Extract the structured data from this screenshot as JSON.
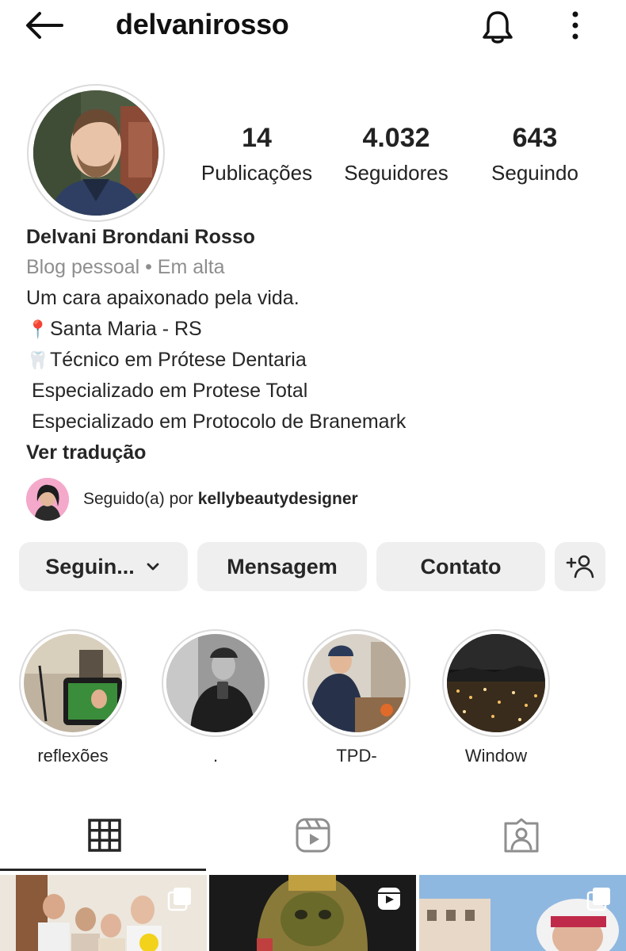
{
  "header": {
    "username": "delvanirosso",
    "back_icon": "arrow-left-icon",
    "notification_icon": "bell-icon",
    "more_icon": "more-vertical-icon"
  },
  "profile": {
    "stats": [
      {
        "value": "14",
        "label": "Publicações"
      },
      {
        "value": "4.032",
        "label": "Seguidores"
      },
      {
        "value": "643",
        "label": "Seguindo"
      }
    ],
    "name": "Delvani Brondani Rosso",
    "category": "Blog pessoal • Em alta",
    "bio_lines": [
      "Um cara apaixonado pela vida.",
      "Santa Maria - RS",
      "Técnico em Prótese Dentaria",
      " Especializado em Protese Total",
      " Especializado em Protocolo de Branemark"
    ],
    "bio_emojis": [
      "📍",
      "🦷"
    ],
    "translate_label": "Ver tradução",
    "followed_by_prefix": "Seguido(a) por ",
    "followed_by_user": "kellybeautydesigner"
  },
  "actions": {
    "following_label": "Seguin...",
    "message_label": "Mensagem",
    "contact_label": "Contato",
    "add_person_icon": "add-person-icon"
  },
  "highlights": [
    {
      "label": "reflexões"
    },
    {
      "label": "."
    },
    {
      "label": "TPD-"
    },
    {
      "label": "Window"
    }
  ],
  "tabs": [
    {
      "icon": "grid-icon",
      "active": true
    },
    {
      "icon": "reels-icon",
      "active": false
    },
    {
      "icon": "tagged-icon",
      "active": false
    }
  ],
  "colors": {
    "button_bg": "#efefef",
    "secondary_text": "#8e8e8e",
    "ring": "#dbdbdb",
    "text": "#262626"
  }
}
